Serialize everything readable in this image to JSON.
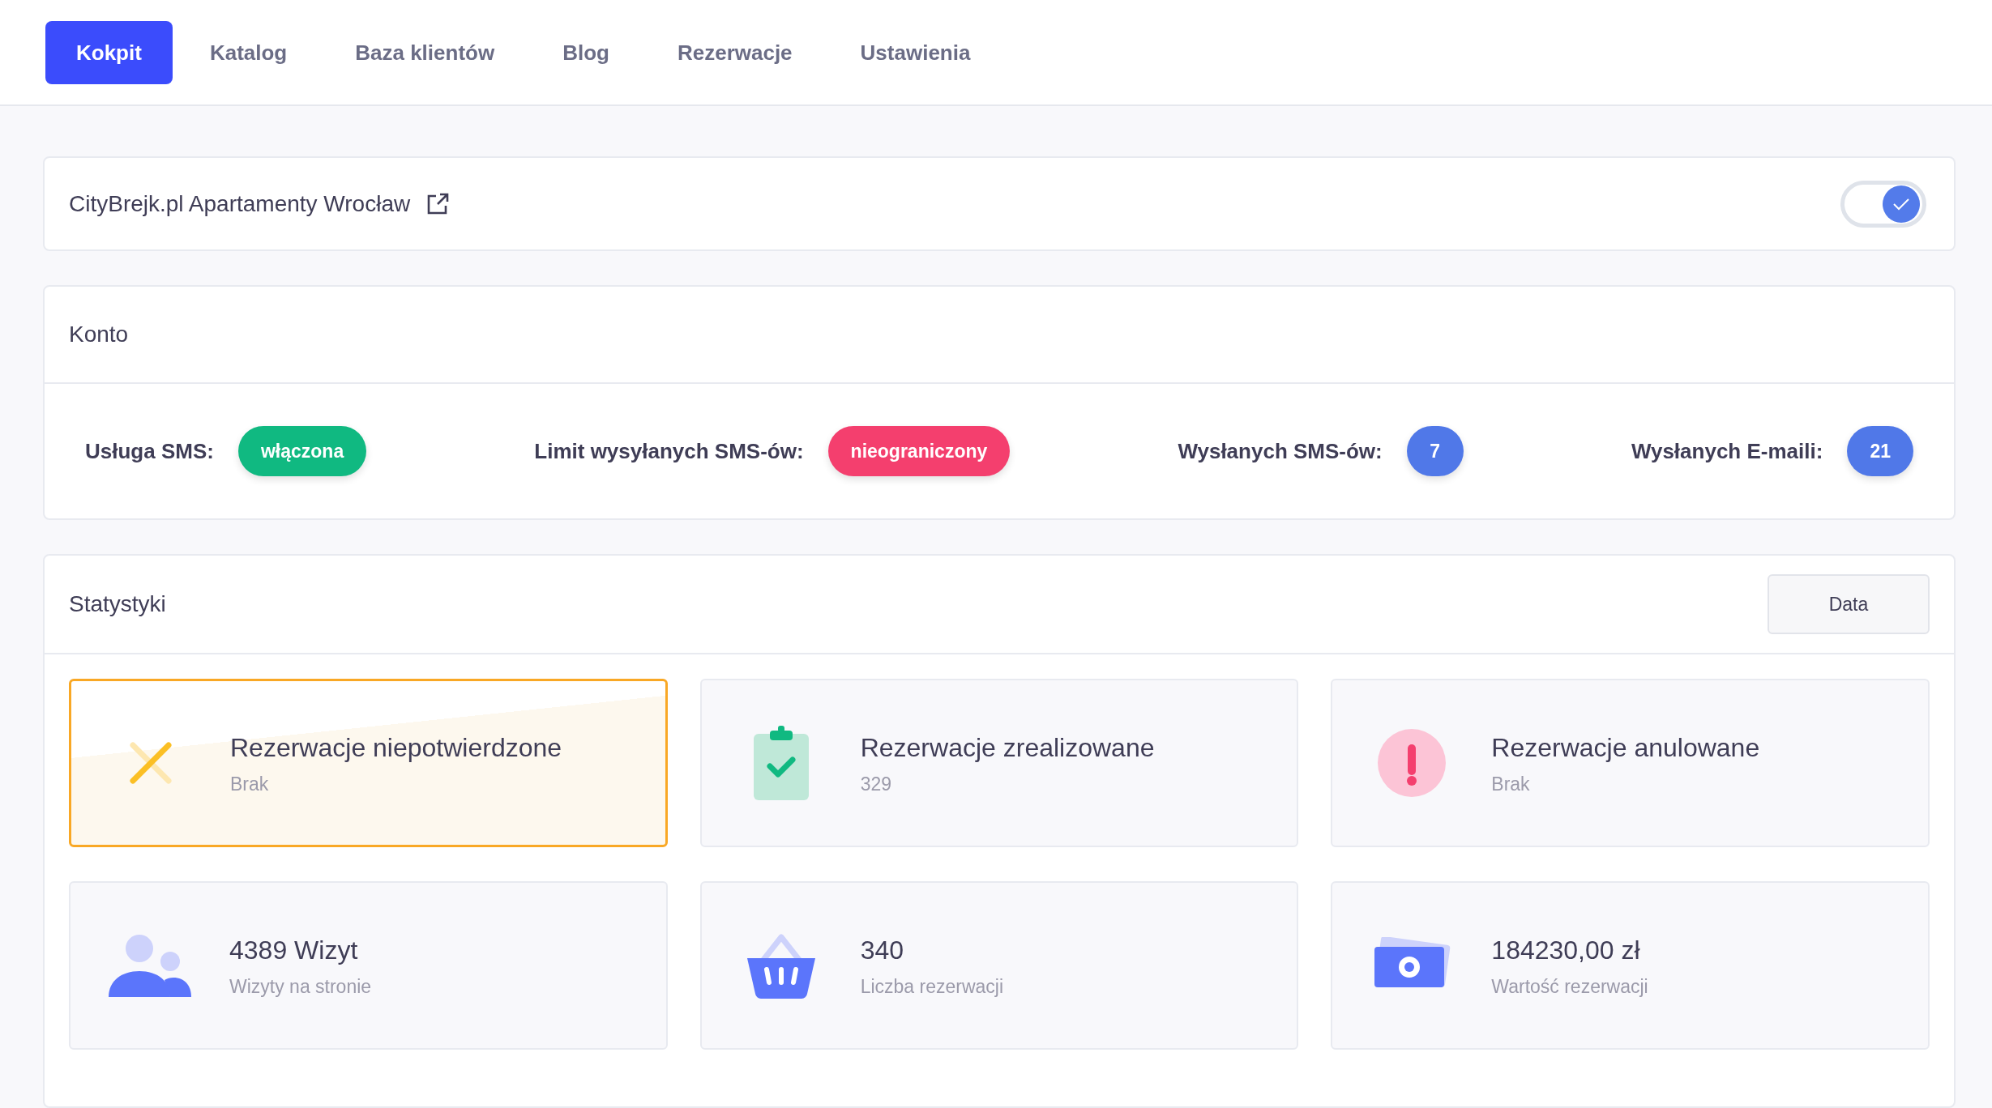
{
  "nav": [
    {
      "label": "Kokpit",
      "selected": true
    },
    {
      "label": "Katalog",
      "selected": false
    },
    {
      "label": "Baza klientów",
      "selected": false
    },
    {
      "label": "Blog",
      "selected": false
    },
    {
      "label": "Rezerwacje",
      "selected": false
    },
    {
      "label": "Ustawienia",
      "selected": false
    }
  ],
  "site": {
    "name": "CityBrejk.pl Apartamenty Wrocław",
    "enabled": true
  },
  "account": {
    "title": "Konto",
    "items": [
      {
        "label": "Usługa SMS:",
        "value": "włączona",
        "color": "#10b981"
      },
      {
        "label": "Limit wysyłanych SMS-ów:",
        "value": "nieograniczony",
        "color": "#f43f6e"
      },
      {
        "label": "Wysłanych SMS-ów:",
        "value": "7",
        "color": "#5078e8"
      },
      {
        "label": "Wysłanych E-maili:",
        "value": "21",
        "color": "#5078e8"
      }
    ]
  },
  "stats": {
    "title": "Statystyki",
    "date_button": "Data",
    "cards": [
      {
        "kind": "cross",
        "title": "Rezerwacje niepotwierdzone",
        "value": "Brak",
        "selected": true
      },
      {
        "kind": "clipboard",
        "title": "Rezerwacje zrealizowane",
        "value": "329",
        "selected": false
      },
      {
        "kind": "alert",
        "title": "Rezerwacje anulowane",
        "value": "Brak",
        "selected": false
      },
      {
        "kind": "users",
        "title": "4389 Wizyt",
        "value": "Wizyty na stronie",
        "selected": false
      },
      {
        "kind": "basket",
        "title": "340",
        "value": "Liczba rezerwacji",
        "selected": false
      },
      {
        "kind": "money",
        "title": "184230,00 zł",
        "value": "Wartość rezerwacji",
        "selected": false
      }
    ]
  }
}
